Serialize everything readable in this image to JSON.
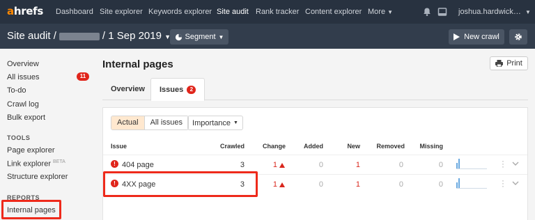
{
  "nav": {
    "logo_a": "a",
    "logo_rest": "hrefs",
    "links": [
      "Dashboard",
      "Site explorer",
      "Keywords explorer",
      "Site audit",
      "Rank tracker",
      "Content explorer",
      "More"
    ],
    "active": "Site audit",
    "user": "joshua.hardwick…",
    "icons": [
      "bell-icon",
      "window-icon",
      "chevron-down-icon"
    ]
  },
  "subheader": {
    "prefix": "Site audit /",
    "date": "/ 1 Sep 2019",
    "segment_label": "Segment",
    "new_crawl_label": "New crawl"
  },
  "sidebar": {
    "items": [
      "Overview",
      "All issues",
      "To-do",
      "Crawl log",
      "Bulk export"
    ],
    "all_issues_count": "11",
    "tools_heading": "TOOLS",
    "tools": [
      "Page explorer",
      "Link explorer",
      "Structure explorer"
    ],
    "link_explorer_tag": "BETA",
    "reports_heading": "REPORTS",
    "reports": [
      "Internal pages"
    ]
  },
  "main": {
    "title": "Internal pages",
    "print_label": "Print",
    "tabs": [
      {
        "label": "Overview"
      },
      {
        "label": "Issues",
        "count": "2"
      }
    ],
    "filter_actual": "Actual",
    "filter_all": "All issues",
    "importance_label": "Importance",
    "columns": [
      "Issue",
      "Crawled",
      "Change",
      "Added",
      "New",
      "Removed",
      "Missing"
    ],
    "rows": [
      {
        "issue": "404 page",
        "crawled": "3",
        "change": "1",
        "added": "0",
        "new": "1",
        "removed": "0",
        "missing": "0"
      },
      {
        "issue": "4XX page",
        "crawled": "3",
        "change": "1",
        "added": "0",
        "new": "1",
        "removed": "0",
        "missing": "0"
      }
    ]
  },
  "colors": {
    "nav_bg": "#283240",
    "subbar_bg": "#323d4c",
    "accent_orange": "#ff8800",
    "alert_red": "#e0251b",
    "highlight_box": "#ee2a1b"
  }
}
